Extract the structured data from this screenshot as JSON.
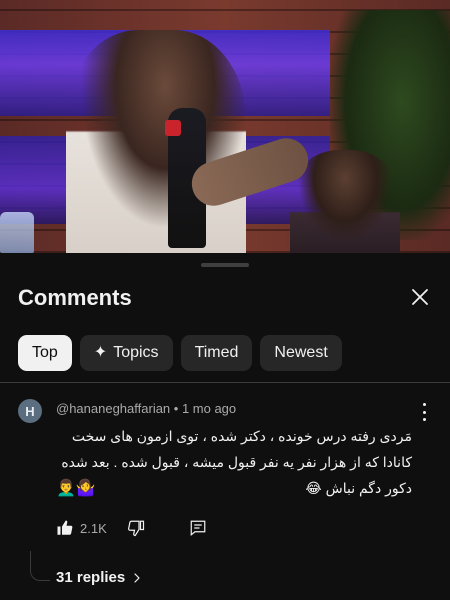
{
  "sheet": {
    "title": "Comments",
    "chips": [
      {
        "label": "Top",
        "active": true
      },
      {
        "label": "Topics",
        "icon": "sparkle-icon"
      },
      {
        "label": "Timed"
      },
      {
        "label": "Newest"
      }
    ]
  },
  "comment": {
    "avatar_letter": "H",
    "author": "@hananeghaffarian",
    "age": "1 mo ago",
    "meta_line": "@hananeghaffarian • 1 mo ago",
    "text_line1": "مَردی رفته درس خونده ، دکتر شده ، توی ازمون های سخت",
    "text_line2": "کانادا که از هزار نفر یه نفر قبول میشه ، قبول شده . بعد شده",
    "text_line3": "دکور دگم نباش 😂",
    "emojis": "👨‍🦱🤷‍♀️",
    "likes": "2.1K",
    "replies": "31 replies"
  },
  "colors": {
    "background": "#0f0f0f",
    "chip": "#272727",
    "chip_active": "#f1f1f1",
    "secondary_text": "#aaaaaa"
  }
}
